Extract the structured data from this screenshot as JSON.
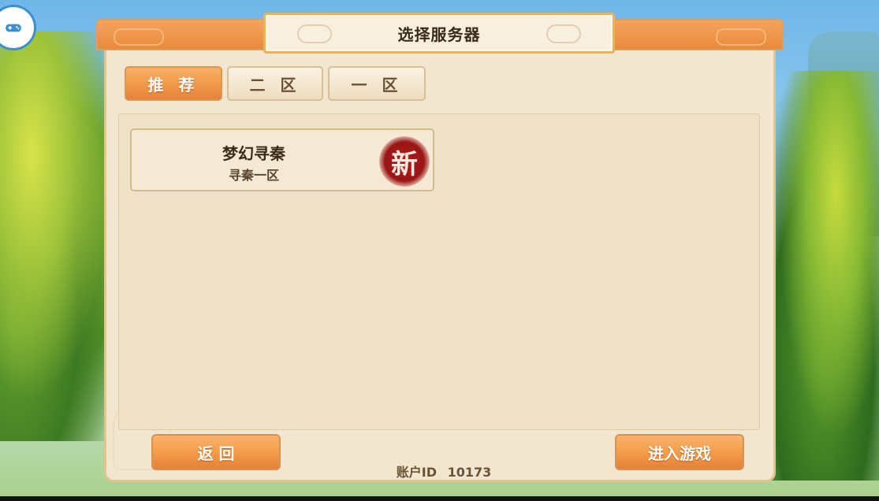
{
  "title": "选择服务器",
  "tabs": [
    {
      "label": "推 荐",
      "active": true
    },
    {
      "label": "二 区",
      "active": false
    },
    {
      "label": "一 区",
      "active": false
    }
  ],
  "servers": [
    {
      "name": "梦幻寻秦",
      "zone": "寻秦一区",
      "badge": "新"
    }
  ],
  "buttons": {
    "back": "返 回",
    "enter": "进入游戏"
  },
  "account": {
    "label": "账户ID",
    "id": "10173"
  },
  "colors": {
    "accent_orange": "#f09a4a",
    "panel_bg": "#f3e6d0",
    "badge_red": "#9a1515"
  },
  "icons": {
    "corner": "gamepad-icon"
  }
}
